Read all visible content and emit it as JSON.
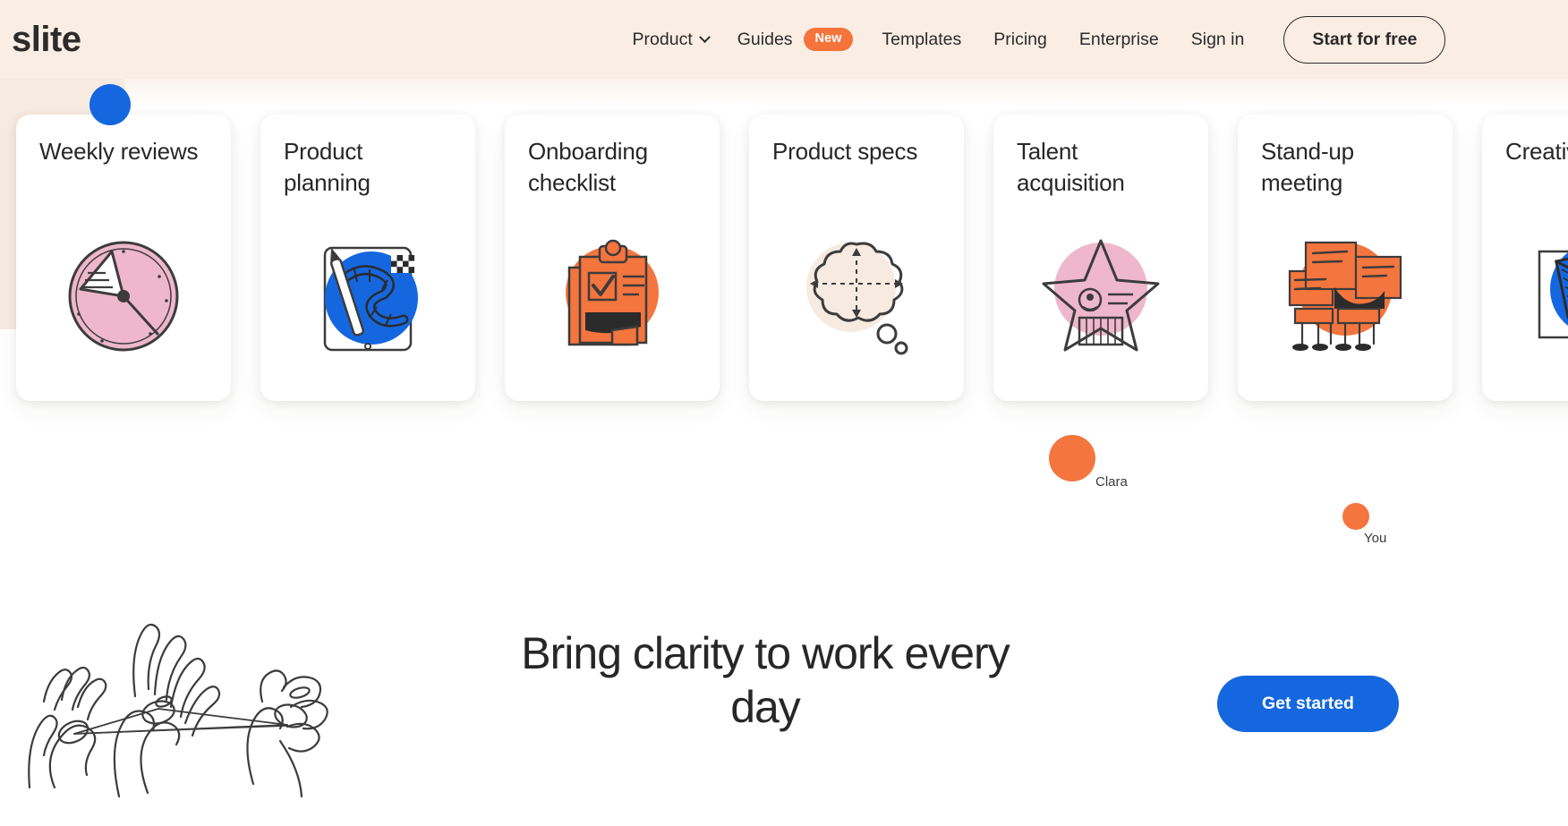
{
  "brand": {
    "logo_text": "slite",
    "colors": {
      "cream": "#faeee4",
      "blue": "#1567e0",
      "orange": "#f4753e",
      "pink": "#efb7cb",
      "dark": "#272727"
    }
  },
  "header": {
    "nav": [
      {
        "label": "Product",
        "has_dropdown": true,
        "icon": "chevron-down-icon"
      },
      {
        "label": "Guides",
        "badge": "New"
      },
      {
        "label": "Templates"
      },
      {
        "label": "Pricing"
      },
      {
        "label": "Enterprise"
      },
      {
        "label": "Sign in"
      }
    ],
    "cta_label": "Start for free"
  },
  "cards": [
    {
      "title": "Weekly reviews",
      "art": "clock-illustration",
      "art_color": "#efb7cb"
    },
    {
      "title": "Product planning",
      "art": "boardgame-illustration",
      "art_color": "#1567e0"
    },
    {
      "title": "Onboarding checklist",
      "art": "clipboard-illustration",
      "art_color": "#f4753e"
    },
    {
      "title": "Product specs",
      "art": "thought-bubble-illustration",
      "art_color": "#f7ebe1"
    },
    {
      "title": "Talent acquisition",
      "art": "star-illustration",
      "art_color": "#efb7cb"
    },
    {
      "title": "Stand-up meeting",
      "art": "people-papers-illustration",
      "art_color": "#f4753e"
    },
    {
      "title": "Creative brief",
      "art": "envelope-illustration",
      "art_color": "#1567e0"
    }
  ],
  "cursors": [
    {
      "name": "blue-cursor",
      "label": "",
      "color": "#1567e0"
    },
    {
      "name": "clara-cursor",
      "label": "Clara",
      "color": "#f4753e"
    },
    {
      "name": "you-cursor",
      "label": "You",
      "color": "#f4753e"
    }
  ],
  "hero": {
    "headline_line1": "Bring clarity to work",
    "headline_line2": "every day",
    "cta_label": "Get started",
    "illustration": "hands-string-illustration"
  }
}
